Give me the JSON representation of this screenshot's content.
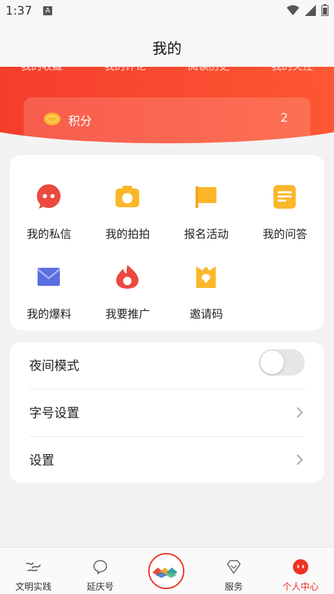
{
  "status_bar": {
    "time": "1:37",
    "notification_letter": "A"
  },
  "page_title": "我的",
  "hero_tabs": [
    "我的收藏",
    "我的评论",
    "阅读历史",
    "我的关注"
  ],
  "points": {
    "label": "积分",
    "value": "2"
  },
  "grid": [
    {
      "label": "我的私信",
      "icon": "chat-bubble-icon"
    },
    {
      "label": "我的拍拍",
      "icon": "camera-icon"
    },
    {
      "label": "报名活动",
      "icon": "flag-icon"
    },
    {
      "label": "我的问答",
      "icon": "note-icon"
    },
    {
      "label": "我的爆料",
      "icon": "envelope-icon"
    },
    {
      "label": "我要推广",
      "icon": "flame-icon"
    },
    {
      "label": "邀请码",
      "icon": "gem-icon"
    }
  ],
  "settings": {
    "night_mode": "夜间模式",
    "night_mode_enabled": false,
    "font_size": "字号设置",
    "settings": "设置"
  },
  "bottom_nav": [
    {
      "label": "文明实践",
      "icon": "calligraphy-logo-icon"
    },
    {
      "label": "延庆号",
      "icon": "bubble-icon"
    },
    {
      "label": "服务",
      "icon": "diamond-icon"
    },
    {
      "label": "个人中心",
      "icon": "profile-face-icon"
    }
  ],
  "colors": {
    "brand_red": "#ef3124",
    "hero_gradient_start": "#f53a2b",
    "hero_gradient_end": "#fe5a34",
    "icon_yellow": "#fbb72a",
    "icon_red": "#ea4a40",
    "icon_blue": "#5b6ee0"
  }
}
